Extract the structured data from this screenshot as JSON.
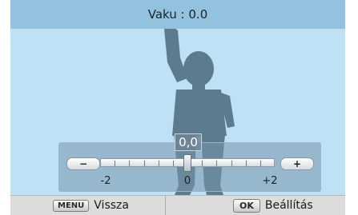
{
  "title": "Vaku : 0.0",
  "slider": {
    "value_label": "0,0",
    "min_label": "-2",
    "mid_label": "0",
    "max_label": "+2",
    "value": 0,
    "range": [
      -2,
      2
    ],
    "minus_glyph": "−",
    "plus_glyph": "+"
  },
  "bottom_bar": {
    "back_key": "MENU",
    "back_label": "Vissza",
    "ok_key": "OK",
    "ok_label": "Beállítás"
  },
  "colors": {
    "sky": "#bfe1f5",
    "title_bar": "#93c2e1",
    "silhouette": "#5b7a8d"
  },
  "icons": [
    "minus-icon",
    "plus-icon"
  ]
}
